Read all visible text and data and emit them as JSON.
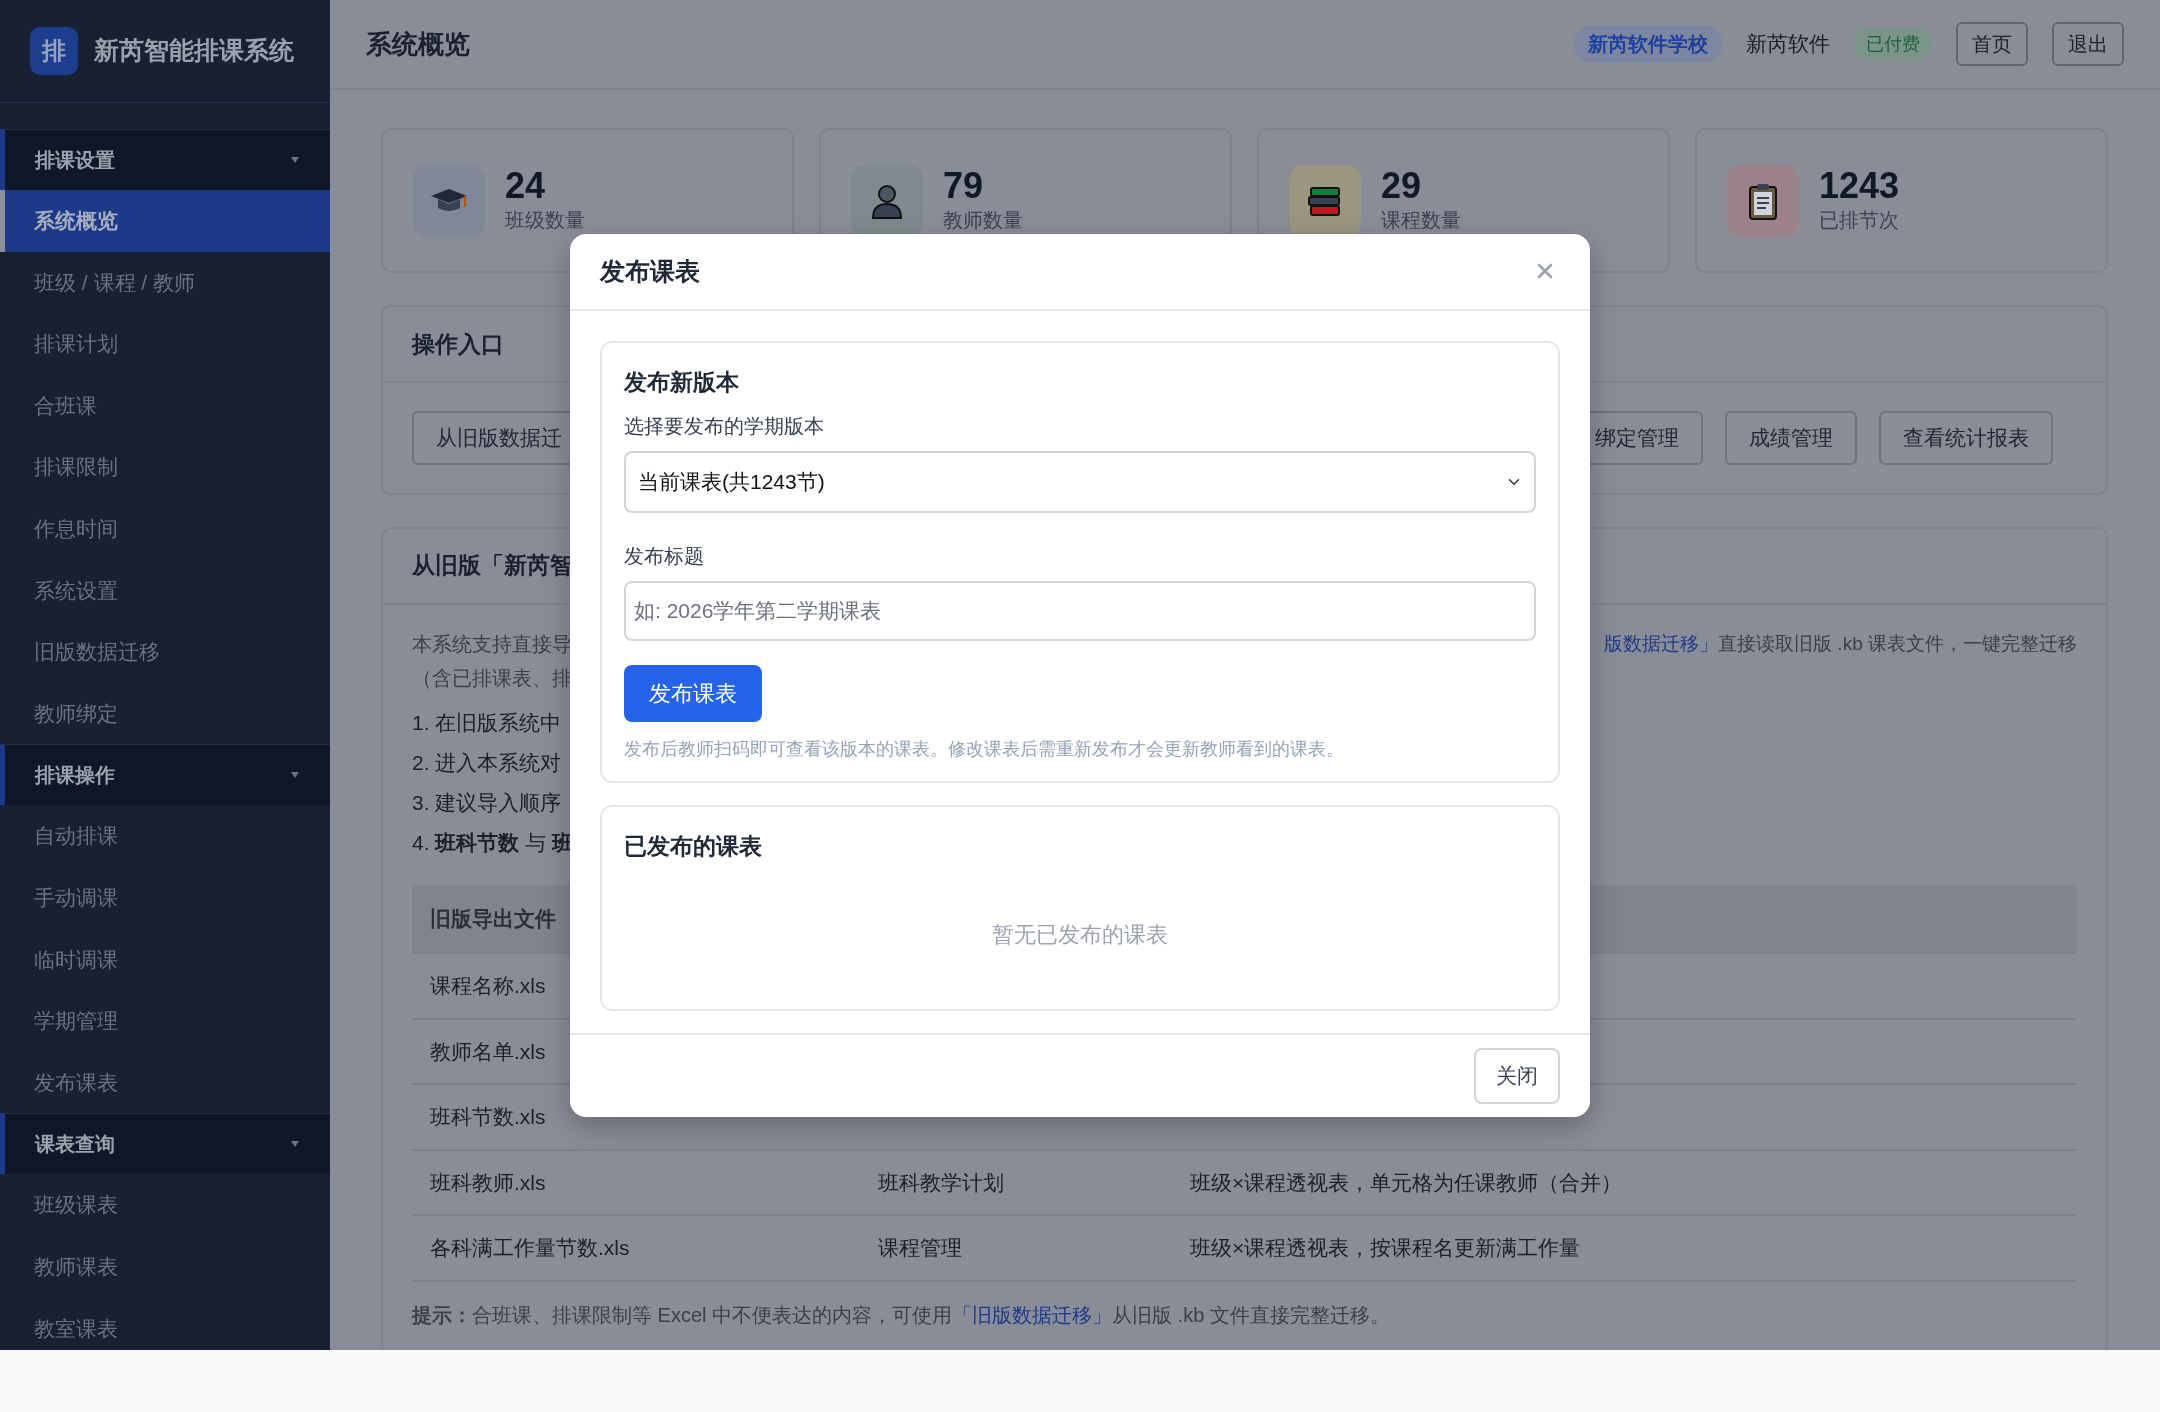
{
  "sidebar": {
    "logo": "排",
    "title": "新芮智能排课系统",
    "groups": [
      {
        "label": "排课设置",
        "expanded": true,
        "items": [
          {
            "label": "系统概览",
            "selected": true
          },
          {
            "label": "班级 / 课程 / 教师",
            "selected": false
          },
          {
            "label": "排课计划",
            "selected": false
          },
          {
            "label": "合班课",
            "selected": false
          },
          {
            "label": "排课限制",
            "selected": false
          },
          {
            "label": "作息时间",
            "selected": false
          },
          {
            "label": "系统设置",
            "selected": false
          },
          {
            "label": "旧版数据迁移",
            "selected": false
          },
          {
            "label": "教师绑定",
            "selected": false
          }
        ]
      },
      {
        "label": "排课操作",
        "expanded": true,
        "items": [
          {
            "label": "自动排课",
            "selected": false
          },
          {
            "label": "手动调课",
            "selected": false
          },
          {
            "label": "临时调课",
            "selected": false
          },
          {
            "label": "学期管理",
            "selected": false
          },
          {
            "label": "发布课表",
            "selected": false
          }
        ]
      },
      {
        "label": "课表查询",
        "expanded": true,
        "items": [
          {
            "label": "班级课表",
            "selected": false
          },
          {
            "label": "教师课表",
            "selected": false
          },
          {
            "label": "教室课表",
            "selected": false
          }
        ]
      }
    ]
  },
  "topbar": {
    "title": "系统概览",
    "school": "新芮软件学校",
    "user": "新芮软件",
    "paid_badge": "已付费",
    "buttons": [
      "首页",
      "退出"
    ]
  },
  "stats": [
    {
      "kind": "class",
      "value": "24",
      "label": "班级数量"
    },
    {
      "kind": "teacher",
      "value": "79",
      "label": "教师数量"
    },
    {
      "kind": "course",
      "value": "29",
      "label": "课程数量"
    },
    {
      "kind": "lesson",
      "value": "1243",
      "label": "已排节次"
    }
  ],
  "operations": {
    "title": "操作入口",
    "buttons_left": [
      "从旧版数据迁"
    ],
    "buttons_right": [
      "绑定管理",
      "成绩管理",
      "查看统计报表"
    ]
  },
  "migration": {
    "title": "从旧版「新芮智",
    "paragraph_left": [
      "本系统支持直接导",
      "（含已排课表、排"
    ],
    "paragraph_right": {
      "link": "版数据迁移」",
      "text": "直接读取旧版 .kb 课表文件，一键完整迁移"
    },
    "steps": [
      "1. 在旧版系统中",
      "2. 进入本系统对",
      "3. 建议导入顺序",
      "4. **班科节数** 与 **班**"
    ],
    "table": {
      "columns": [
        "旧版导出文件"
      ],
      "rows": [
        {
          "file": "课程名称.xls"
        },
        {
          "file": "教师名单.xls"
        },
        {
          "file": "班科节数.xls"
        },
        {
          "file": "班科教师.xls",
          "target": "班科教学计划",
          "note": "班级×课程透视表，单元格为任课教师（合并）"
        },
        {
          "file": "各科满工作量节数.xls",
          "target": "课程管理",
          "note": "班级×课程透视表，按课程名更新满工作量"
        }
      ]
    },
    "tip": {
      "before": "**提示：**合班课、排课限制等 Excel 中不便表达的内容，可使用",
      "link": "「旧版数据迁移」",
      "after": "从旧版 .kb 文件直接完整迁移。"
    }
  },
  "modal": {
    "title": "发布课表",
    "new_version": {
      "title": "发布新版本",
      "select_label": "选择要发布的学期版本",
      "select_value": "当前课表(共1243节)",
      "title_label": "发布标题",
      "title_placeholder": "如: 2026学年第二学期课表",
      "button": "发布课表",
      "hint": "发布后教师扫码即可查看该版本的课表。修改课表后需重新发布才会更新教师看到的课表。"
    },
    "published": {
      "title": "已发布的课表",
      "empty": "暂无已发布的课表"
    },
    "close_button": "关闭"
  }
}
